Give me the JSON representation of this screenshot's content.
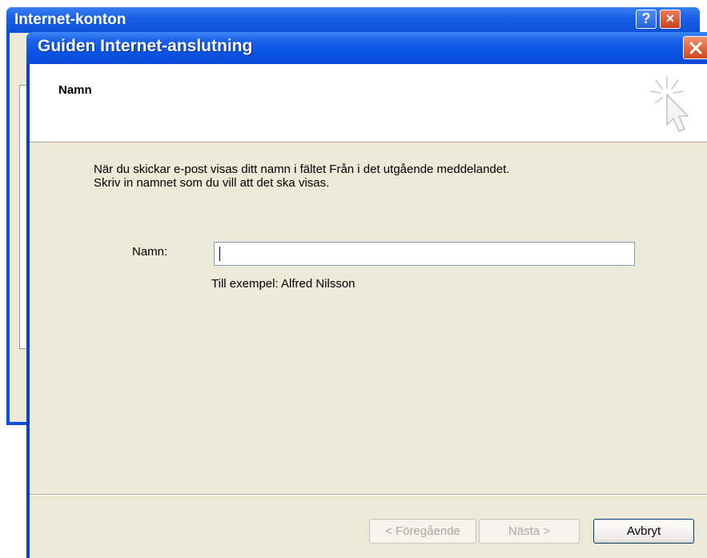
{
  "background_window": {
    "title": "Internet-konton",
    "help_label": "?",
    "close_label": "×"
  },
  "wizard": {
    "title": "Guiden Internet-anslutning",
    "header_title": "Namn",
    "description_line1": "När du skickar e-post visas ditt namn i fältet Från i det utgående meddelandet.",
    "description_line2": "Skriv in namnet som du vill att det ska visas.",
    "name_label": "Namn:",
    "name_value": "",
    "example_text": "Till exempel: Alfred Nilsson",
    "buttons": {
      "back": "< Föregående",
      "next": "Nästa >",
      "cancel": "Avbryt"
    }
  },
  "colors": {
    "titlebar_blue": "#0a55e4",
    "close_red": "#d0461c",
    "dialog_face": "#ece9d8"
  }
}
